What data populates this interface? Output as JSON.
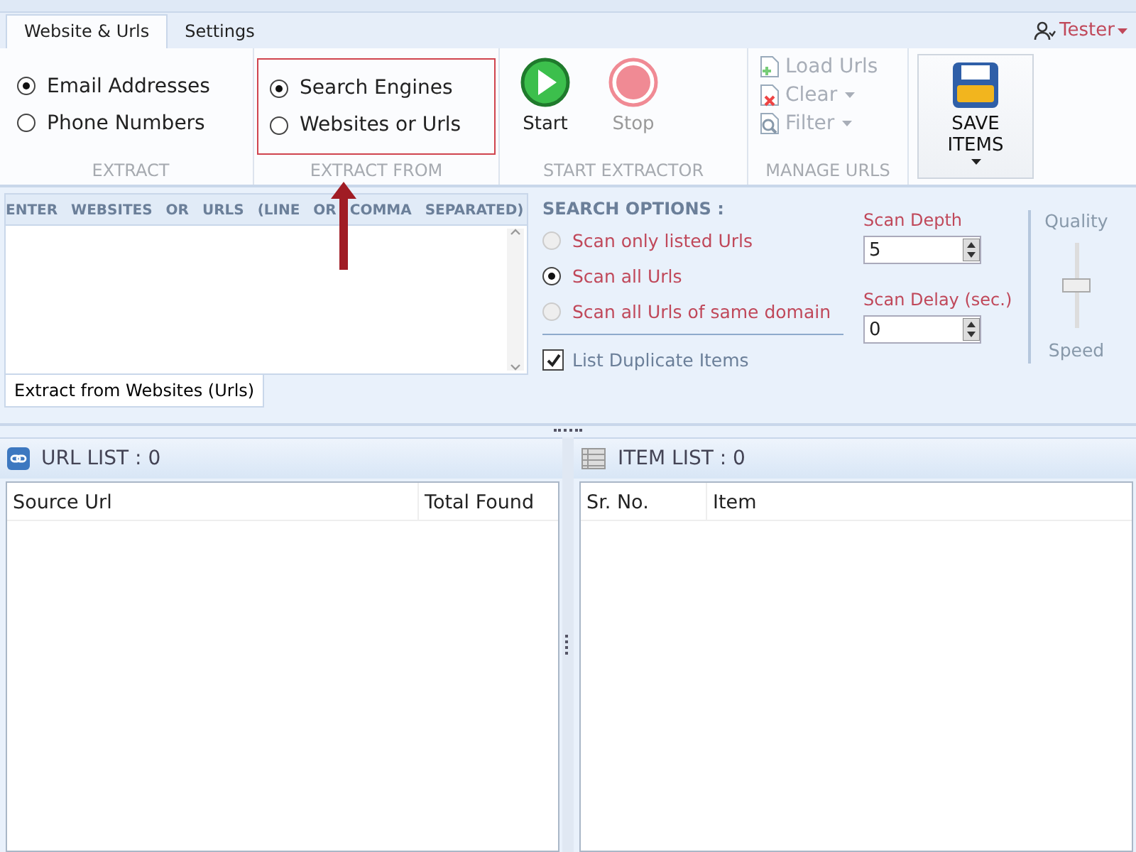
{
  "tabs": [
    {
      "label": "Website & Urls",
      "selected": true
    },
    {
      "label": "Settings",
      "selected": false
    }
  ],
  "user": {
    "name": "Tester"
  },
  "ribbon": {
    "extract": {
      "caption": "EXTRACT",
      "options": [
        {
          "label": "Email Addresses",
          "selected": true
        },
        {
          "label": "Phone Numbers",
          "selected": false
        }
      ]
    },
    "extract_from": {
      "caption": "EXTRACT FROM",
      "highlighted": true,
      "options": [
        {
          "label": "Search Engines",
          "selected": true
        },
        {
          "label": "Websites or Urls",
          "selected": false
        }
      ]
    },
    "start_extractor": {
      "caption": "START EXTRACTOR",
      "buttons": [
        {
          "label": "Start",
          "kind": "start",
          "disabled": false
        },
        {
          "label": "Stop",
          "kind": "stop",
          "disabled": true
        }
      ]
    },
    "manage_urls": {
      "caption": "MANAGE URLS",
      "items": [
        {
          "label": "Load Urls",
          "kind": "load",
          "dropdown": false
        },
        {
          "label": "Clear",
          "kind": "clear",
          "dropdown": true
        },
        {
          "label": "Filter",
          "kind": "filter",
          "dropdown": true
        }
      ]
    },
    "save_items": {
      "label": "SAVE ITEMS"
    }
  },
  "urls_panel": {
    "title": "ENTER WEBSITES OR URLS (LINE OR COMMA SEPARATED)",
    "tab": "Extract from Websites (Urls)"
  },
  "search_options": {
    "title": "SEARCH OPTIONS :",
    "scan_modes": [
      {
        "label": "Scan only listed Urls",
        "selected": false,
        "disabled": true
      },
      {
        "label": "Scan all Urls",
        "selected": true,
        "disabled": false
      },
      {
        "label": "Scan all Urls of same domain",
        "selected": false,
        "disabled": true
      }
    ],
    "list_duplicates": {
      "label": "List Duplicate Items",
      "checked": true
    },
    "scan_depth": {
      "label": "Scan Depth",
      "value": "5"
    },
    "scan_delay": {
      "label": "Scan Delay (sec.)",
      "value": "0"
    },
    "quality_slider": {
      "top_label": "Quality",
      "bottom_label": "Speed",
      "level": 0.5
    }
  },
  "url_list": {
    "title": "URL LIST : 0",
    "columns": [
      "Source Url",
      "Total Found"
    ]
  },
  "item_list": {
    "title": "ITEM LIST : 0",
    "columns": [
      "Sr. No.",
      "Item"
    ]
  }
}
